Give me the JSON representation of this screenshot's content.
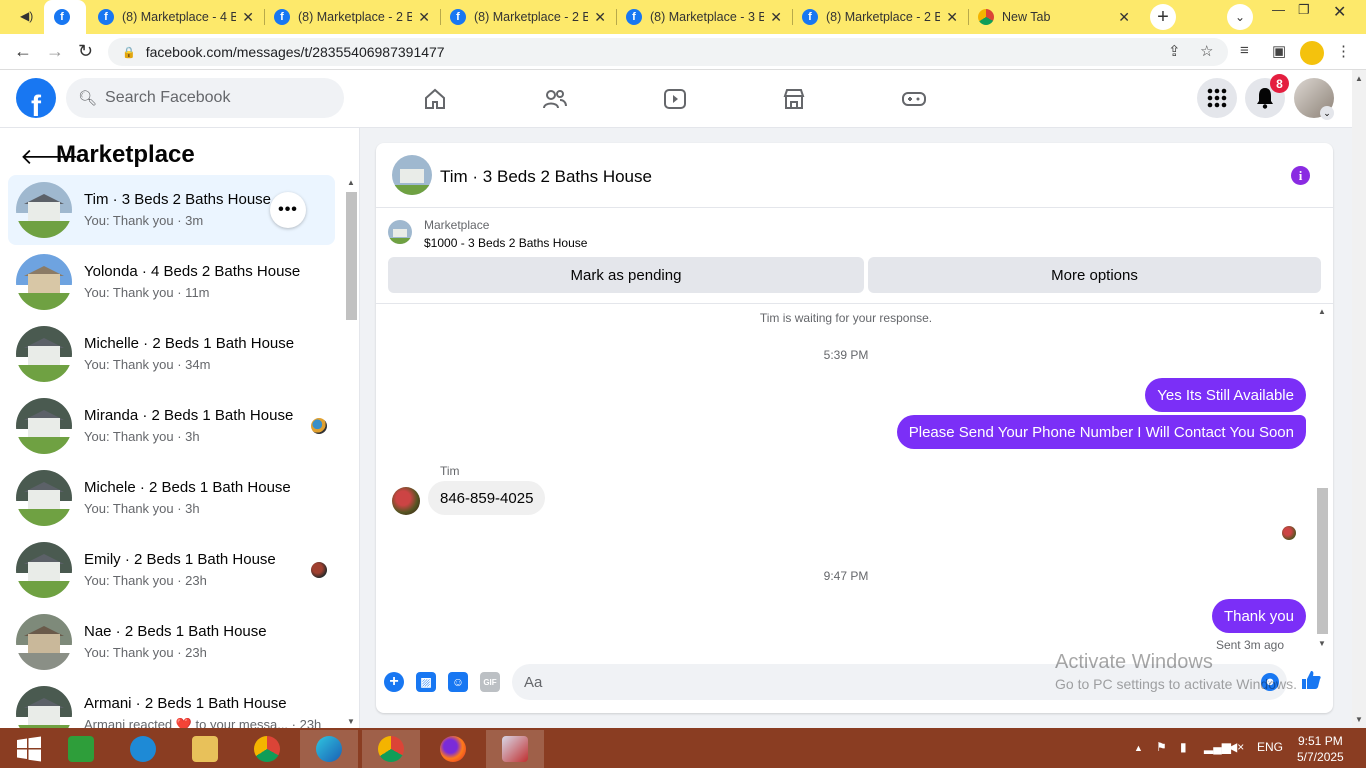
{
  "browser": {
    "tabs": [
      {
        "label": "(8) Marketplace - 4 B",
        "favicon": "facebook-icon"
      },
      {
        "label": "(8) Marketplace - 2 B",
        "favicon": "facebook-icon"
      },
      {
        "label": "(8) Marketplace - 2 B",
        "favicon": "facebook-icon"
      },
      {
        "label": "(8) Marketplace - 3 B",
        "favicon": "facebook-icon"
      },
      {
        "label": "(8) Marketplace - 2 B",
        "favicon": "facebook-icon"
      },
      {
        "label": "New Tab",
        "favicon": "chrome-icon"
      }
    ],
    "url": "facebook.com/messages/t/28355406987391477"
  },
  "fb": {
    "search_placeholder": "Search Facebook",
    "notification_count": "8"
  },
  "sidebar": {
    "title": "Marketplace",
    "conversations": [
      {
        "name": "Tim · 3 Beds 2 Baths House",
        "preview": "You: Thank you · 3m",
        "active": true
      },
      {
        "name": "Yolonda · 4 Beds 2 Baths House",
        "preview": "You: Thank you · 11m"
      },
      {
        "name": "Michelle · 2 Beds 1 Bath House",
        "preview": "You: Thank you · 34m"
      },
      {
        "name": "Miranda · 2 Beds 1 Bath House",
        "preview": "You: Thank you · 3h"
      },
      {
        "name": "Michele · 2 Beds 1 Bath House",
        "preview": "You: Thank you · 3h"
      },
      {
        "name": "Emily · 2 Beds 1 Bath House",
        "preview": "You: Thank you · 23h"
      },
      {
        "name": "Nae · 2 Beds 1 Bath House",
        "preview": "You: Thank you · 23h"
      },
      {
        "name": "Armani · 2 Beds 1 Bath House",
        "preview": "Armani reacted ❤️ to your messa... · 23h"
      }
    ]
  },
  "chat": {
    "title": "Tim · 3 Beds 2 Baths House",
    "listing_source": "Marketplace",
    "listing_price": "$1000 - 3 Beds 2 Baths House",
    "mark_pending": "Mark as pending",
    "more_options": "More options",
    "waiting_text": "Tim is waiting for your response.",
    "time1": "5:39 PM",
    "out1": "Yes Its Still Available",
    "out2": "Please Send Your Phone Number I Will Contact You Soon",
    "sender": "Tim",
    "in1": "846-859-4025",
    "time2": "9:47 PM",
    "out3": "Thank you",
    "sent_status": "Sent 3m ago",
    "input_placeholder": "Aa"
  },
  "watermark": {
    "line1": "Activate Windows",
    "line2": "Go to PC settings to activate Windows."
  },
  "taskbar": {
    "language": "ENG",
    "time": "9:51 PM",
    "date": "5/7/2025"
  },
  "colors": {
    "tabstrip": "#fde96b",
    "fb_blue": "#1877f2",
    "outgoing_bubble": "#7b2ff7",
    "taskbar": "#8a3d22"
  }
}
